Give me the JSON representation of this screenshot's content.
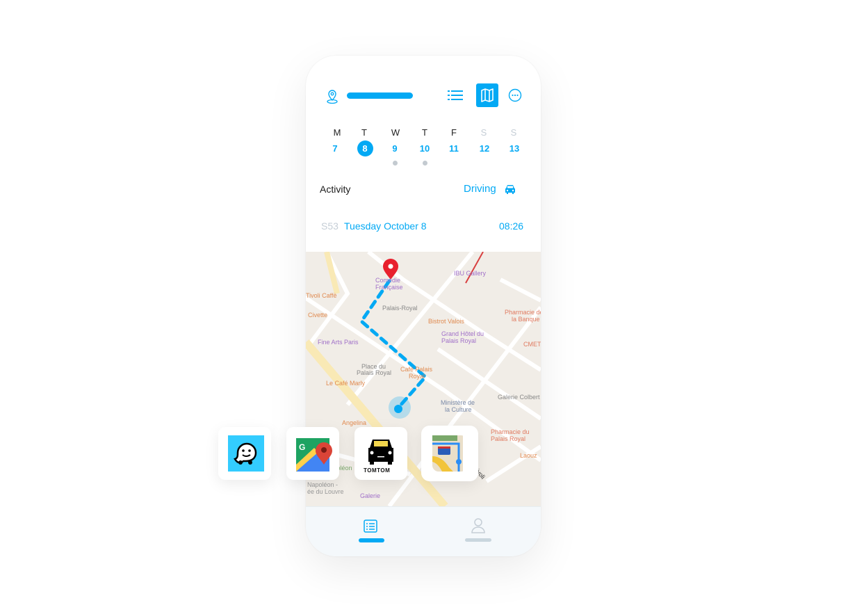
{
  "header": {
    "icons": [
      "location-pin-icon",
      "list-view-icon",
      "map-view-icon",
      "more-icon"
    ],
    "active_view": "map"
  },
  "calendar": {
    "days": [
      {
        "letter": "M",
        "num": "7",
        "weekend": false,
        "dot": false,
        "selected": false
      },
      {
        "letter": "T",
        "num": "8",
        "weekend": false,
        "dot": false,
        "selected": true
      },
      {
        "letter": "W",
        "num": "9",
        "weekend": false,
        "dot": true,
        "selected": false
      },
      {
        "letter": "T",
        "num": "10",
        "weekend": false,
        "dot": true,
        "selected": false
      },
      {
        "letter": "F",
        "num": "11",
        "weekend": false,
        "dot": false,
        "selected": false
      },
      {
        "letter": "S",
        "num": "12",
        "weekend": true,
        "dot": false,
        "selected": false
      },
      {
        "letter": "S",
        "num": "13",
        "weekend": true,
        "dot": false,
        "selected": false
      }
    ]
  },
  "activity": {
    "label": "Activity",
    "mode": "Driving",
    "mode_icon": "car-icon"
  },
  "trip": {
    "week": "S53",
    "date": "Tuesday October 8",
    "time": "08:26"
  },
  "map": {
    "labels": [
      {
        "t": "Comédie",
        "c": "#a070c8"
      },
      {
        "t": "Française",
        "c": "#a070c8"
      },
      {
        "t": "IBU Gallery",
        "c": "#a070c8"
      },
      {
        "t": "Tivoli Caffè",
        "c": "#e08a50"
      },
      {
        "t": "Palais-Royal",
        "c": "#888"
      },
      {
        "t": "Civette",
        "c": "#e08a50"
      },
      {
        "t": "Bistrot Valois",
        "c": "#e08a50"
      },
      {
        "t": "Pharmacie de",
        "c": "#e07a60"
      },
      {
        "t": "la Banque",
        "c": "#e07a60"
      },
      {
        "t": "Grand Hôtel du",
        "c": "#a070c8"
      },
      {
        "t": "Palais Royal",
        "c": "#a070c8"
      },
      {
        "t": "Fine Arts Paris",
        "c": "#a070c8"
      },
      {
        "t": "CMET",
        "c": "#e07a60"
      },
      {
        "t": "Place du",
        "c": "#888"
      },
      {
        "t": "Palais Royal",
        "c": "#888"
      },
      {
        "t": "Café Palais",
        "c": "#e08a50"
      },
      {
        "t": "Royal",
        "c": "#e08a50"
      },
      {
        "t": "Le Café Marly",
        "c": "#e08a50"
      },
      {
        "t": "Ministère de",
        "c": "#7a8aa8"
      },
      {
        "t": "la Culture",
        "c": "#7a8aa8"
      },
      {
        "t": "Galerie Colbert",
        "c": "#888"
      },
      {
        "t": "Angelina",
        "c": "#e08a50"
      },
      {
        "t": "Pharmacie du",
        "c": "#e07a60"
      },
      {
        "t": "Palais Royal",
        "c": "#e07a60"
      },
      {
        "t": "Laouz",
        "c": "#e08a50"
      },
      {
        "t": "Cour Napoléon",
        "c": "#7aa86a"
      },
      {
        "t": "Napoléon -",
        "c": "#999"
      },
      {
        "t": "ée du Louvre",
        "c": "#999"
      },
      {
        "t": "Galerie",
        "c": "#a070c8"
      },
      {
        "t": "Rivoli",
        "c": "#333"
      }
    ]
  },
  "nav_apps": [
    {
      "name": "Waze",
      "icon": "waze-icon"
    },
    {
      "name": "Google Maps",
      "icon": "google-maps-icon"
    },
    {
      "name": "TomTom",
      "logo_text": "TOMTOM",
      "icon": "tomtom-icon"
    },
    {
      "name": "Apple Maps",
      "icon": "apple-maps-icon",
      "shield": "280"
    }
  ],
  "tabbar": {
    "items": [
      "trips-list-icon",
      "profile-icon"
    ],
    "active": 0
  },
  "colors": {
    "accent": "#03a9f4",
    "pin": "#e8202e",
    "muted": "#c5ced6",
    "tabbar": "#f4f8fb"
  }
}
